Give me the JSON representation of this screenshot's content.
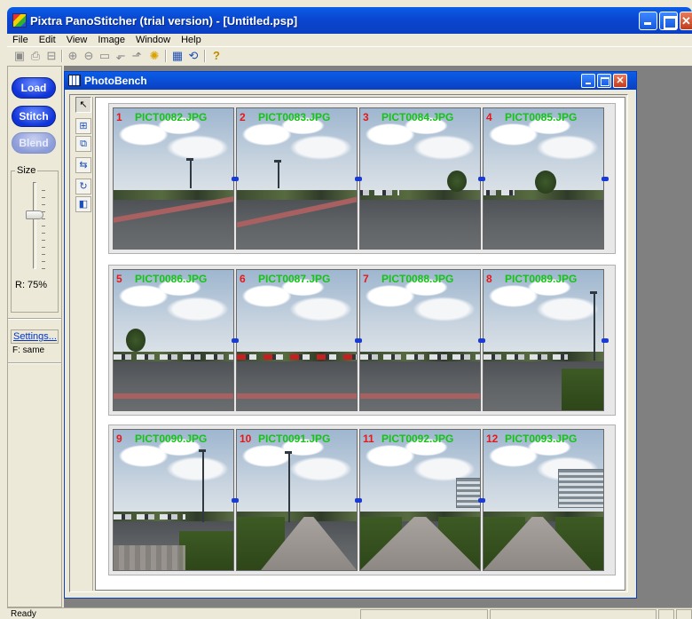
{
  "window": {
    "title": "Pixtra PanoStitcher (trial version) - [Untitled.psp]"
  },
  "menu": [
    "File",
    "Edit",
    "View",
    "Image",
    "Window",
    "Help"
  ],
  "toolbar": [
    "save-icon",
    "print-icon",
    "print-preview-icon",
    "zoom-in-icon",
    "zoom-out-icon",
    "fit-icon",
    "rotate-left-icon",
    "rotate-right-icon",
    "brightness-icon",
    "photobench-icon",
    "stitch-icon",
    "help-icon"
  ],
  "left_panel": {
    "load_label": "Load",
    "stitch_label": "Stitch",
    "blend_label": "Blend",
    "size_label": "Size",
    "size_value": "R: 75%",
    "settings_label": "Settings...",
    "f_value": "F: same"
  },
  "child": {
    "title": "PhotoBench"
  },
  "photos": [
    {
      "num": "1",
      "name": "PICT0082.JPG"
    },
    {
      "num": "2",
      "name": "PICT0083.JPG"
    },
    {
      "num": "3",
      "name": "PICT0084.JPG"
    },
    {
      "num": "4",
      "name": "PICT0085.JPG"
    },
    {
      "num": "5",
      "name": "PICT0086.JPG"
    },
    {
      "num": "6",
      "name": "PICT0087.JPG"
    },
    {
      "num": "7",
      "name": "PICT0088.JPG"
    },
    {
      "num": "8",
      "name": "PICT0089.JPG"
    },
    {
      "num": "9",
      "name": "PICT0090.JPG"
    },
    {
      "num": "10",
      "name": "PICT0091.JPG"
    },
    {
      "num": "11",
      "name": "PICT0092.JPG"
    },
    {
      "num": "12",
      "name": "PICT0093.JPG"
    }
  ],
  "status": {
    "text": "Ready"
  },
  "colors": {
    "titlebar": "#0a46d0",
    "photo_number": "#e81818",
    "photo_name": "#15c415",
    "link_marker": "#1a3ad8"
  }
}
